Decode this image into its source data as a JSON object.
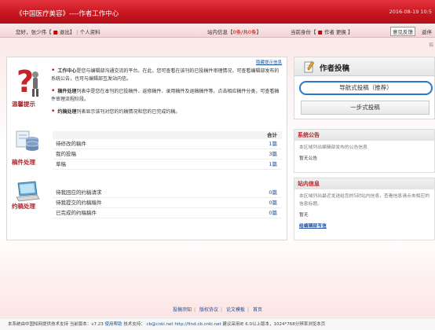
{
  "header": {
    "title": "《中国医疗美容》----作者工作中心",
    "date": "2016-08-19 10:5"
  },
  "userbar": {
    "greeting": "您好，张少伟【",
    "logout": "退出",
    "greeting_end": "】",
    "sep": "|",
    "profile": "个人资料",
    "site_info_label": "站内信息【",
    "site_info_value": "0条/共0条",
    "site_info_end": "】",
    "identity_label": "当前身份【",
    "identity_value": "作者",
    "switch": "更换",
    "identity_end": "】",
    "feedback": "意见反馈",
    "return": "返伴"
  },
  "topright": "稿",
  "help": {
    "hide_link": "隐藏提示信息",
    "label": "温馨提示",
    "items": [
      {
        "bold": "工作中心",
        "text": "是您与编辑部沟通交流的平台。在此，您可查看在该刊的已投稿件审理情况，可查看编辑部发布的系统公告，也可与编辑部互发站内信。"
      },
      {
        "bold": "稿件处理",
        "text": "列表中是您在本刊的已投稿件、返修稿件、录用稿件及退稿稿件等。点击相应稿件分类，可查看稿件审理流程阶段。"
      },
      {
        "bold": "约稿处理",
        "text": "列表显示该刊对您的约稿情况和您的已完成约稿。"
      }
    ]
  },
  "manuscripts": {
    "label": "稿件处理",
    "total_header": "合计",
    "rows": [
      {
        "name": "待修改的稿件",
        "count": "1篇"
      },
      {
        "name": "我的投稿",
        "count": "3篇"
      },
      {
        "name": "草稿",
        "count": "1篇"
      }
    ]
  },
  "invitations": {
    "label": "约稿处理",
    "rows": [
      {
        "name": "待我回应的约稿请求",
        "count": "0篇"
      },
      {
        "name": "待我提交的约稿稿件",
        "count": "0篇"
      },
      {
        "name": "已完成的约稿稿件",
        "count": "0篇"
      }
    ]
  },
  "author_submit": {
    "title": "作者投稿",
    "guided_button": "导航式投稿（推荐）",
    "onestep_button": "一步式投稿"
  },
  "system_notice": {
    "title": "系统公告",
    "desc": "本区域列出编辑部发布的公告信息",
    "empty": "暂无公告"
  },
  "site_messages": {
    "title": "站内信息",
    "desc": "本区域列出最近发送给您的5封站内信息，查看信息请点击相应的信息标题。",
    "empty": "暂无",
    "send_link": "给编辑部写信"
  },
  "footer_links": [
    "投稿须知",
    "版权协议",
    "论文模板",
    "首页"
  ],
  "footer_bar": {
    "support": "本系统由中国知网提供技术支持 当前版本：v7.23",
    "help": "使用帮助",
    "tech": "技术支持：",
    "email": "cb@cnki.net",
    "url": "http://find.cb.cnki.net",
    "tip": "建议采用IE 6.0以上版本，1024*768分辨率浏览本页"
  }
}
